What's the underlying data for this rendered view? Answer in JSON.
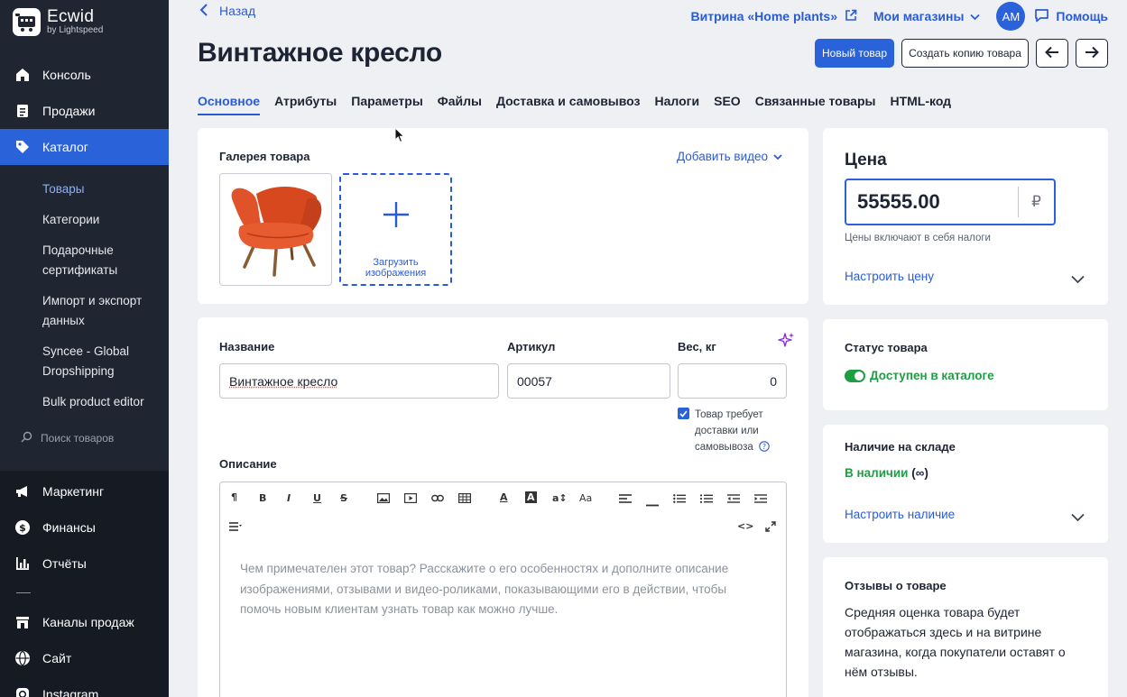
{
  "brand": {
    "name": "Ecwid",
    "byline": "by Lightspeed"
  },
  "sidebar": {
    "items": [
      {
        "label": "Консоль"
      },
      {
        "label": "Продажи"
      },
      {
        "label": "Каталог"
      }
    ],
    "catalog_sub": [
      {
        "label": "Товары"
      },
      {
        "label": "Категории"
      },
      {
        "label": "Подарочные сертификаты"
      },
      {
        "label": "Импорт и экспорт данных"
      },
      {
        "label": "Syncee - Global Dropshipping"
      },
      {
        "label": "Bulk product editor"
      }
    ],
    "search_placeholder": "Поиск товаров",
    "lower_items": [
      {
        "label": "Маркетинг"
      },
      {
        "label": "Финансы"
      },
      {
        "label": "Отчёты"
      },
      {
        "label": "Каналы продаж"
      },
      {
        "label": "Сайт"
      },
      {
        "label": "Instagram"
      }
    ]
  },
  "topbar": {
    "back_label": "Назад",
    "storefront_label": "Витрина «Home plants»",
    "stores_label": "Мои магазины",
    "avatar_initials": "AM",
    "help_label": "Помощь"
  },
  "page_title": "Винтажное кресло",
  "actions": {
    "new_product": "Новый товар",
    "duplicate": "Создать копию товара"
  },
  "tabs": [
    {
      "label": "Основное"
    },
    {
      "label": "Атрибуты"
    },
    {
      "label": "Параметры"
    },
    {
      "label": "Файлы"
    },
    {
      "label": "Доставка и самовывоз"
    },
    {
      "label": "Налоги"
    },
    {
      "label": "SEO"
    },
    {
      "label": "Связанные товары"
    },
    {
      "label": "HTML-код"
    }
  ],
  "gallery": {
    "title": "Галерея товара",
    "add_video": "Добавить видео",
    "upload_label": "Загрузить изображения"
  },
  "details": {
    "name_label": "Название",
    "name_value": "Винтажное кресло",
    "sku_label": "Артикул",
    "sku_value": "00057",
    "weight_label": "Вес, кг",
    "weight_value": "0",
    "shipping_checkbox": "Товар требует доставки или самовывоза",
    "description_label": "Описание",
    "description_placeholder": "Чем примечателен этот товар? Расскажите о его особенностях и дополните описание изображениями, отзывами и видео-роликами, показывающими его в действии, чтобы помочь новым клиентам узнать товар как можно лучше."
  },
  "price": {
    "title": "Цена",
    "value": "55555.00",
    "currency": "₽",
    "tax_note": "Цены включают в себя налоги",
    "configure": "Настроить цену"
  },
  "status": {
    "title": "Статус товара",
    "value": "Доступен в каталоге"
  },
  "stock": {
    "title": "Наличие на складе",
    "value": "В наличии",
    "qty": "(∞)",
    "configure": "Настроить наличие"
  },
  "reviews": {
    "title": "Отзывы о товаре",
    "text": "Средняя оценка товара будет отображаться здесь и на витрине магазина, когда покупатели оставят о нём отзывы."
  },
  "colors": {
    "accent": "#2a62d9",
    "success": "#1e9e42",
    "sidebar": "#1f2531"
  }
}
